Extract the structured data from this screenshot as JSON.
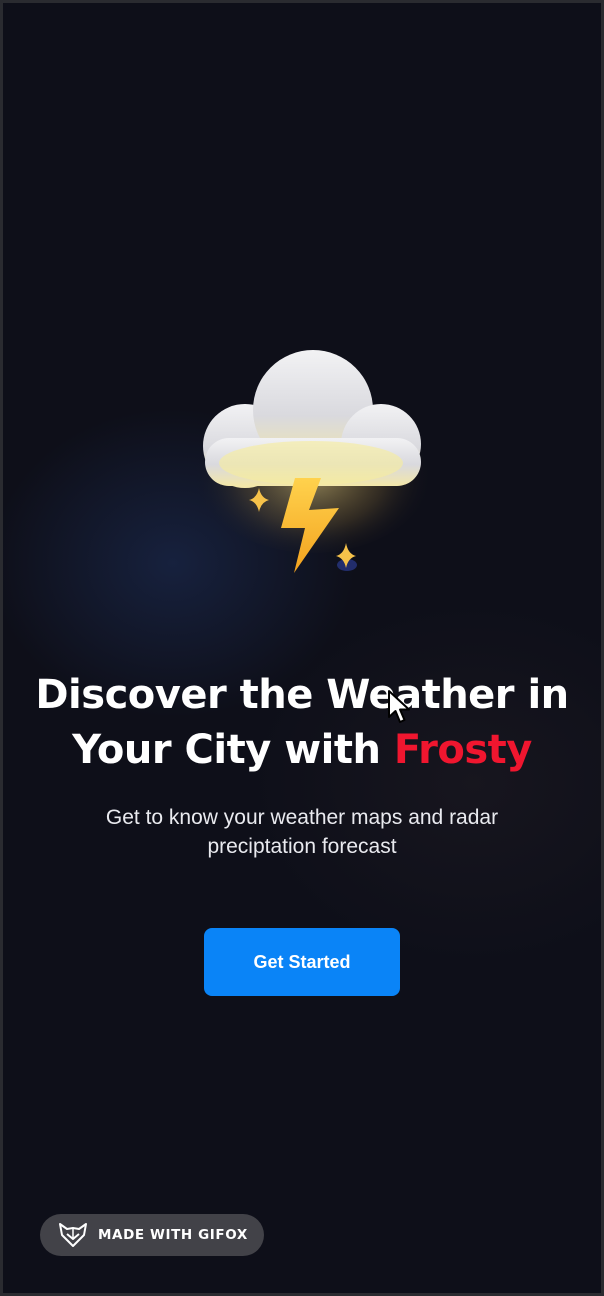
{
  "onboarding": {
    "illustration_icon": "thunderstorm-cloud-icon",
    "headline_line1": "Discover the Weather in",
    "headline_line2_prefix": "Your City with ",
    "headline_brand": "Frosty",
    "subtitle_line1": "Get to know your weather maps and radar",
    "subtitle_line2": "preciptation forecast",
    "cta_label": "Get Started"
  },
  "watermark": {
    "text": "MADE WITH GIFOX",
    "icon": "fox-logo-icon"
  },
  "colors": {
    "background": "#0e0f19",
    "brand_accent": "#f0162f",
    "primary_button": "#0a84f7",
    "text_primary": "#ffffff"
  }
}
